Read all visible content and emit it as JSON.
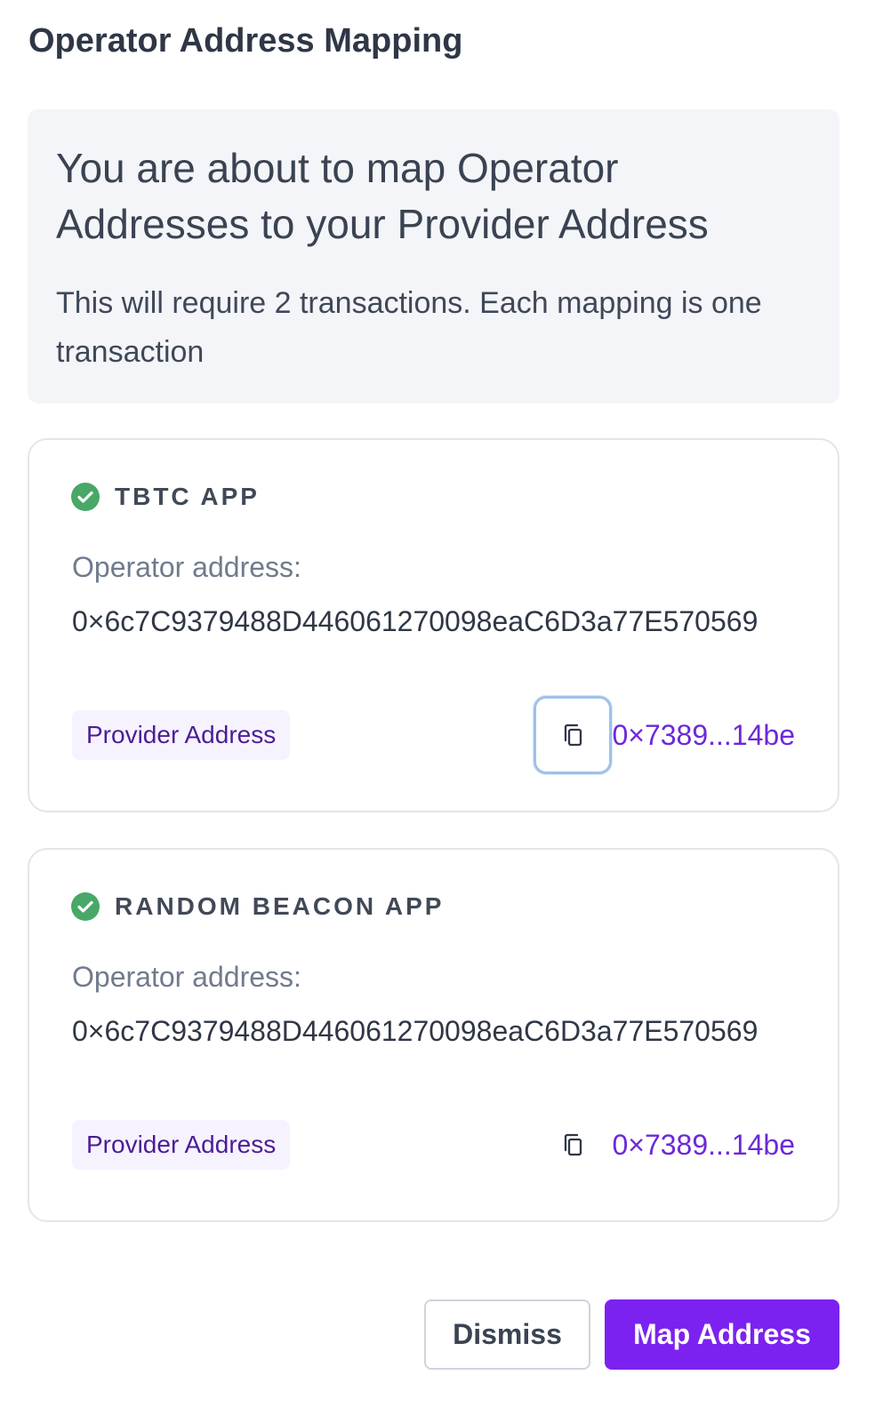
{
  "modal": {
    "title": "Operator Address Mapping"
  },
  "info": {
    "heading": "You are about to map Operator Addresses to your Provider Address",
    "description": "This will require 2 transactions. Each mapping is one transaction"
  },
  "apps": [
    {
      "name": "TBTC APP",
      "operator_label": "Operator address:",
      "operator_address": "0×6c7C9379488D446061270098eaC6D3a77E570569",
      "provider_label": "Provider Address",
      "provider_address": "0×7389...14be",
      "copy_icon": "copy-icon",
      "status_icon": "check-circle-icon"
    },
    {
      "name": "RANDOM BEACON APP",
      "operator_label": "Operator address:",
      "operator_address": "0×6c7C9379488D446061270098eaC6D3a77E570569",
      "provider_label": "Provider Address",
      "provider_address": "0×7389...14be",
      "copy_icon": "copy-icon",
      "status_icon": "check-circle-icon"
    }
  ],
  "buttons": {
    "dismiss": "Dismiss",
    "map_address": "Map Address"
  },
  "colors": {
    "accent": "#7c22f0",
    "link": "#6d28d9",
    "success": "#48a868",
    "focus_ring": "#9fc1e8"
  }
}
